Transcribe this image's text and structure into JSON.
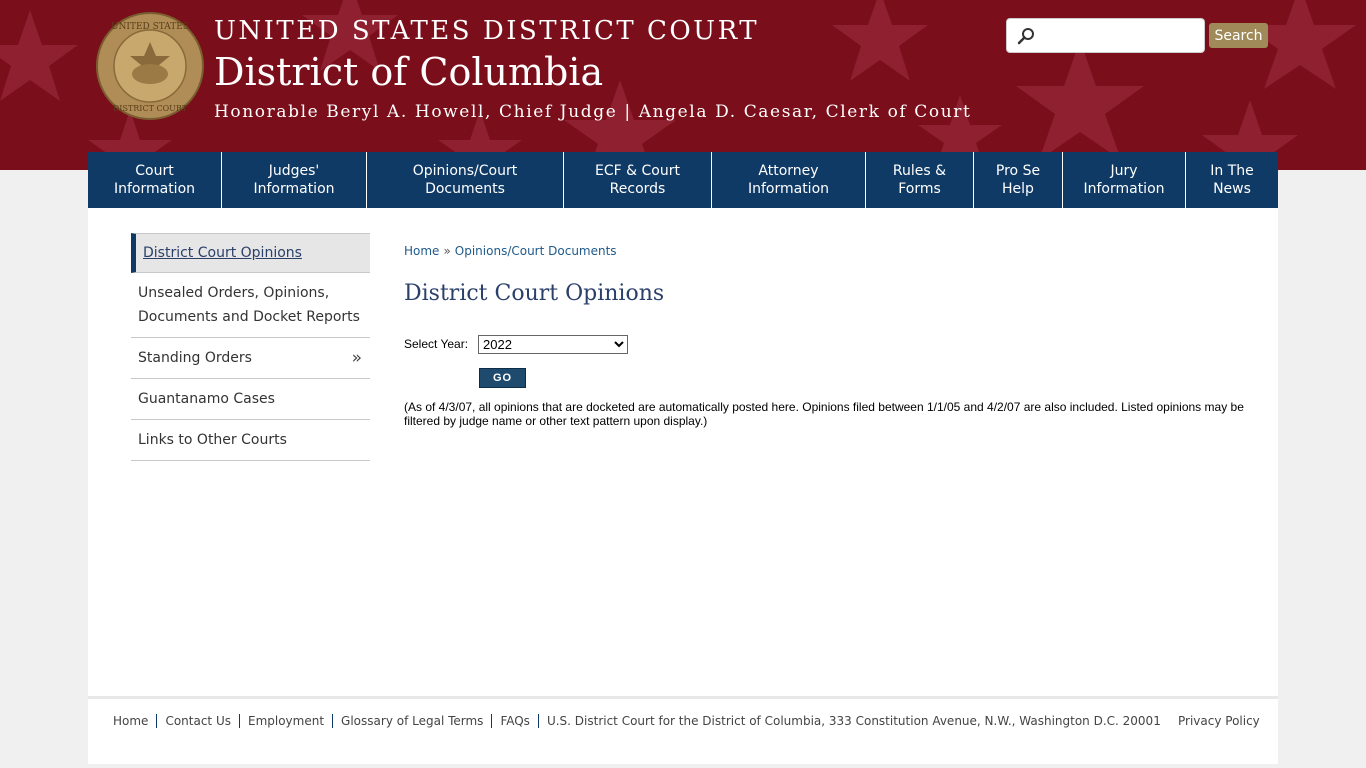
{
  "header": {
    "court_line": "UNITED STATES DISTRICT COURT",
    "district": "District of Columbia",
    "judges_line": "Honorable Beryl A. Howell, Chief Judge | Angela D. Caesar, Clerk of Court",
    "seal_text_top": "UNITED STATES",
    "seal_text_bottom": "DISTRICT COURT",
    "search_placeholder": "",
    "search_button": "Search"
  },
  "nav": [
    "Court\nInformation",
    "Judges'\nInformation",
    "Opinions/Court\nDocuments",
    "ECF & Court\nRecords",
    "Attorney\nInformation",
    "Rules &\nForms",
    "Pro Se\nHelp",
    "Jury\nInformation",
    "In The\nNews"
  ],
  "sidebar": {
    "items": [
      {
        "label": "District Court Opinions"
      },
      {
        "label": "Unsealed Orders, Opinions, Documents and Docket Reports"
      },
      {
        "label": "Standing Orders",
        "chevron": "»"
      },
      {
        "label": "Guantanamo Cases"
      },
      {
        "label": "Links to Other Courts"
      }
    ]
  },
  "breadcrumb": {
    "home": "Home",
    "separator": "»",
    "current": "Opinions/Court Documents"
  },
  "main": {
    "title": "District Court Opinions",
    "select_label": "Select Year:",
    "selected_year": "2022",
    "go_label": "GO",
    "note": "(As of 4/3/07, all opinions that are docketed are automatically posted here. Opinions filed between 1/1/05 and 4/2/07 are also included. Listed opinions may be filtered by judge name or other text pattern upon display.)"
  },
  "footer": {
    "links": [
      "Home",
      "Contact Us",
      "Employment",
      "Glossary of Legal Terms",
      "FAQs",
      "U.S. District Court for the District of Columbia, 333 Constitution Avenue, N.W., Washington D.C. 20001"
    ],
    "privacy": "Privacy Policy"
  },
  "colors": {
    "banner": "#7a0e1a",
    "nav": "#0f3a66",
    "accent_gold": "#a08a5a"
  }
}
